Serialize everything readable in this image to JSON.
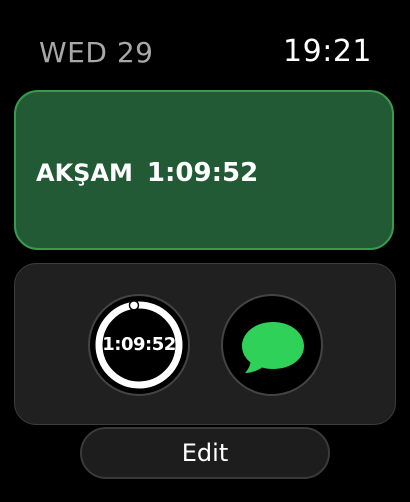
{
  "status_bar": {
    "date": "WED 29",
    "time": "19:21"
  },
  "prayer_widget": {
    "prayer_name": "AKŞAM",
    "countdown": "1:09:52",
    "background_color": "#215a34",
    "border_color": "#3a9a4e"
  },
  "complications": {
    "timer": {
      "value": "1:09:52",
      "ring_progress": 0.98,
      "ring_color": "#ffffff",
      "icon": "timer-ring-icon"
    },
    "messages": {
      "icon": "messages-bubble-icon",
      "icon_color": "#30d158"
    }
  },
  "edit_button": {
    "label": "Edit"
  }
}
